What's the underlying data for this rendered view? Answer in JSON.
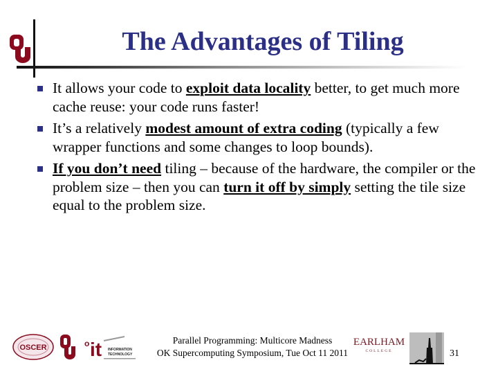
{
  "slide": {
    "title": "The Advantages of Tiling",
    "accent_color": "#2b2f86",
    "bullets": [
      {
        "parts": [
          {
            "text": "It allows your code to ",
            "emph": false
          },
          {
            "text": "exploit data locality",
            "emph": true
          },
          {
            "text": " better, to get much more cache reuse: your code runs faster!",
            "emph": false
          }
        ]
      },
      {
        "parts": [
          {
            "text": "It’s a relatively ",
            "emph": false
          },
          {
            "text": "modest amount of extra coding",
            "emph": true
          },
          {
            "text": " (typically a few wrapper functions and some changes to loop bounds).",
            "emph": false
          }
        ]
      },
      {
        "parts": [
          {
            "text": "If you don’t need",
            "emph": true
          },
          {
            "text": " tiling – because of the hardware, the compiler or the problem size – then you can  ",
            "emph": false
          },
          {
            "text": "turn it off by simply",
            "emph": true
          },
          {
            "text": " setting the tile size equal to the problem size.",
            "emph": false
          }
        ]
      }
    ]
  },
  "footer": {
    "line1": "Parallel Programming: Multicore Madness",
    "line2": "OK Supercomputing Symposium, Tue Oct 11 2011",
    "page_number": "31",
    "logos": {
      "oscer": "OSCER",
      "it_line1": "INFORMATION",
      "it_line2": "TECHNOLOGY",
      "earlham_name": "EARLHAM",
      "earlham_sub": "COLLEGE"
    }
  }
}
